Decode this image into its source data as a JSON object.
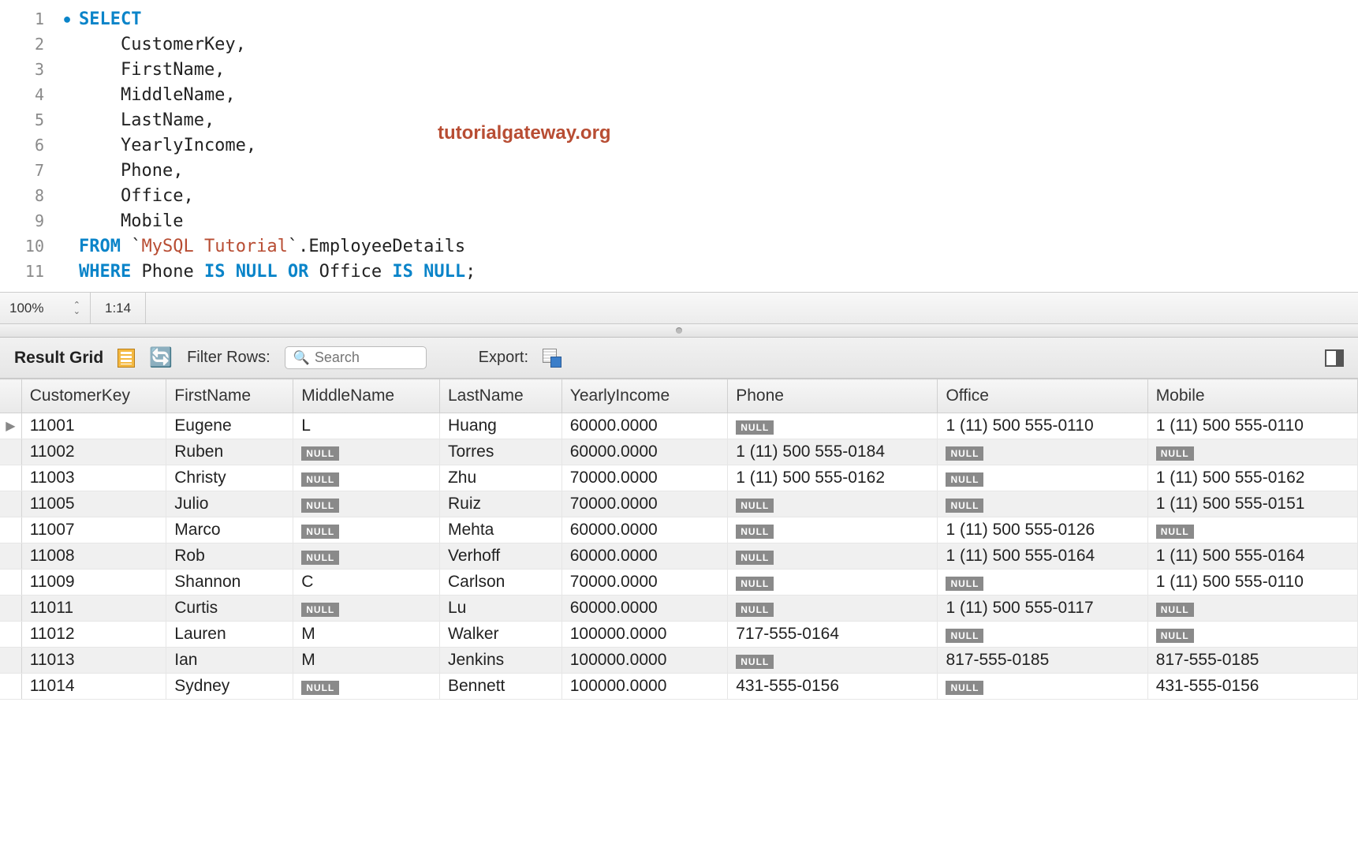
{
  "watermark": "tutorialgateway.org",
  "editor": {
    "lines": [
      {
        "n": 1,
        "bullet": true,
        "tokens": [
          {
            "t": "SELECT",
            "c": "kw"
          }
        ]
      },
      {
        "n": 2,
        "bullet": false,
        "tokens": [
          {
            "t": "    CustomerKey,",
            "c": "txt"
          }
        ]
      },
      {
        "n": 3,
        "bullet": false,
        "tokens": [
          {
            "t": "    FirstName,",
            "c": "txt"
          }
        ]
      },
      {
        "n": 4,
        "bullet": false,
        "tokens": [
          {
            "t": "    MiddleName,",
            "c": "txt"
          }
        ]
      },
      {
        "n": 5,
        "bullet": false,
        "tokens": [
          {
            "t": "    LastName,",
            "c": "txt"
          }
        ]
      },
      {
        "n": 6,
        "bullet": false,
        "tokens": [
          {
            "t": "    YearlyIncome,",
            "c": "txt"
          }
        ]
      },
      {
        "n": 7,
        "bullet": false,
        "tokens": [
          {
            "t": "    Phone,",
            "c": "txt"
          }
        ]
      },
      {
        "n": 8,
        "bullet": false,
        "tokens": [
          {
            "t": "    Office,",
            "c": "txt"
          }
        ]
      },
      {
        "n": 9,
        "bullet": false,
        "tokens": [
          {
            "t": "    Mobile",
            "c": "txt"
          }
        ]
      },
      {
        "n": 10,
        "bullet": false,
        "tokens": [
          {
            "t": "FROM",
            "c": "kw"
          },
          {
            "t": " `",
            "c": "txt"
          },
          {
            "t": "MySQL Tutorial",
            "c": "str"
          },
          {
            "t": "`.EmployeeDetails",
            "c": "txt"
          }
        ]
      },
      {
        "n": 11,
        "bullet": false,
        "tokens": [
          {
            "t": "WHERE",
            "c": "kw"
          },
          {
            "t": " Phone ",
            "c": "txt"
          },
          {
            "t": "IS NULL OR",
            "c": "kw"
          },
          {
            "t": " Office ",
            "c": "txt"
          },
          {
            "t": "IS NULL",
            "c": "kw"
          },
          {
            "t": ";",
            "c": "txt"
          }
        ]
      }
    ]
  },
  "statusbar": {
    "zoom": "100%",
    "cursor": "1:14"
  },
  "toolbar": {
    "result_grid_label": "Result Grid",
    "filter_rows_label": "Filter Rows:",
    "search_placeholder": "Search",
    "export_label": "Export:"
  },
  "grid": {
    "columns": [
      "CustomerKey",
      "FirstName",
      "MiddleName",
      "LastName",
      "YearlyIncome",
      "Phone",
      "Office",
      "Mobile"
    ],
    "rows": [
      {
        "marker": "▶",
        "CustomerKey": "11001",
        "FirstName": "Eugene",
        "MiddleName": "L",
        "LastName": "Huang",
        "YearlyIncome": "60000.0000",
        "Phone": null,
        "Office": "1 (11) 500 555-0110",
        "Mobile": "1 (11) 500 555-0110"
      },
      {
        "marker": "",
        "CustomerKey": "11002",
        "FirstName": "Ruben",
        "MiddleName": null,
        "LastName": "Torres",
        "YearlyIncome": "60000.0000",
        "Phone": "1 (11) 500 555-0184",
        "Office": null,
        "Mobile": null
      },
      {
        "marker": "",
        "CustomerKey": "11003",
        "FirstName": "Christy",
        "MiddleName": null,
        "LastName": "Zhu",
        "YearlyIncome": "70000.0000",
        "Phone": "1 (11) 500 555-0162",
        "Office": null,
        "Mobile": "1 (11) 500 555-0162"
      },
      {
        "marker": "",
        "CustomerKey": "11005",
        "FirstName": "Julio",
        "MiddleName": null,
        "LastName": "Ruiz",
        "YearlyIncome": "70000.0000",
        "Phone": null,
        "Office": null,
        "Mobile": "1 (11) 500 555-0151"
      },
      {
        "marker": "",
        "CustomerKey": "11007",
        "FirstName": "Marco",
        "MiddleName": null,
        "LastName": "Mehta",
        "YearlyIncome": "60000.0000",
        "Phone": null,
        "Office": "1 (11) 500 555-0126",
        "Mobile": null
      },
      {
        "marker": "",
        "CustomerKey": "11008",
        "FirstName": "Rob",
        "MiddleName": null,
        "LastName": "Verhoff",
        "YearlyIncome": "60000.0000",
        "Phone": null,
        "Office": "1 (11) 500 555-0164",
        "Mobile": "1 (11) 500 555-0164"
      },
      {
        "marker": "",
        "CustomerKey": "11009",
        "FirstName": "Shannon",
        "MiddleName": "C",
        "LastName": "Carlson",
        "YearlyIncome": "70000.0000",
        "Phone": null,
        "Office": null,
        "Mobile": "1 (11) 500 555-0110"
      },
      {
        "marker": "",
        "CustomerKey": "11011",
        "FirstName": "Curtis",
        "MiddleName": null,
        "LastName": "Lu",
        "YearlyIncome": "60000.0000",
        "Phone": null,
        "Office": "1 (11) 500 555-0117",
        "Mobile": null
      },
      {
        "marker": "",
        "CustomerKey": "11012",
        "FirstName": "Lauren",
        "MiddleName": "M",
        "LastName": "Walker",
        "YearlyIncome": "100000.0000",
        "Phone": "717-555-0164",
        "Office": null,
        "Mobile": null
      },
      {
        "marker": "",
        "CustomerKey": "11013",
        "FirstName": "Ian",
        "MiddleName": "M",
        "LastName": "Jenkins",
        "YearlyIncome": "100000.0000",
        "Phone": null,
        "Office": "817-555-0185",
        "Mobile": "817-555-0185"
      },
      {
        "marker": "",
        "CustomerKey": "11014",
        "FirstName": "Sydney",
        "MiddleName": null,
        "LastName": "Bennett",
        "YearlyIncome": "100000.0000",
        "Phone": "431-555-0156",
        "Office": null,
        "Mobile": "431-555-0156"
      }
    ]
  }
}
